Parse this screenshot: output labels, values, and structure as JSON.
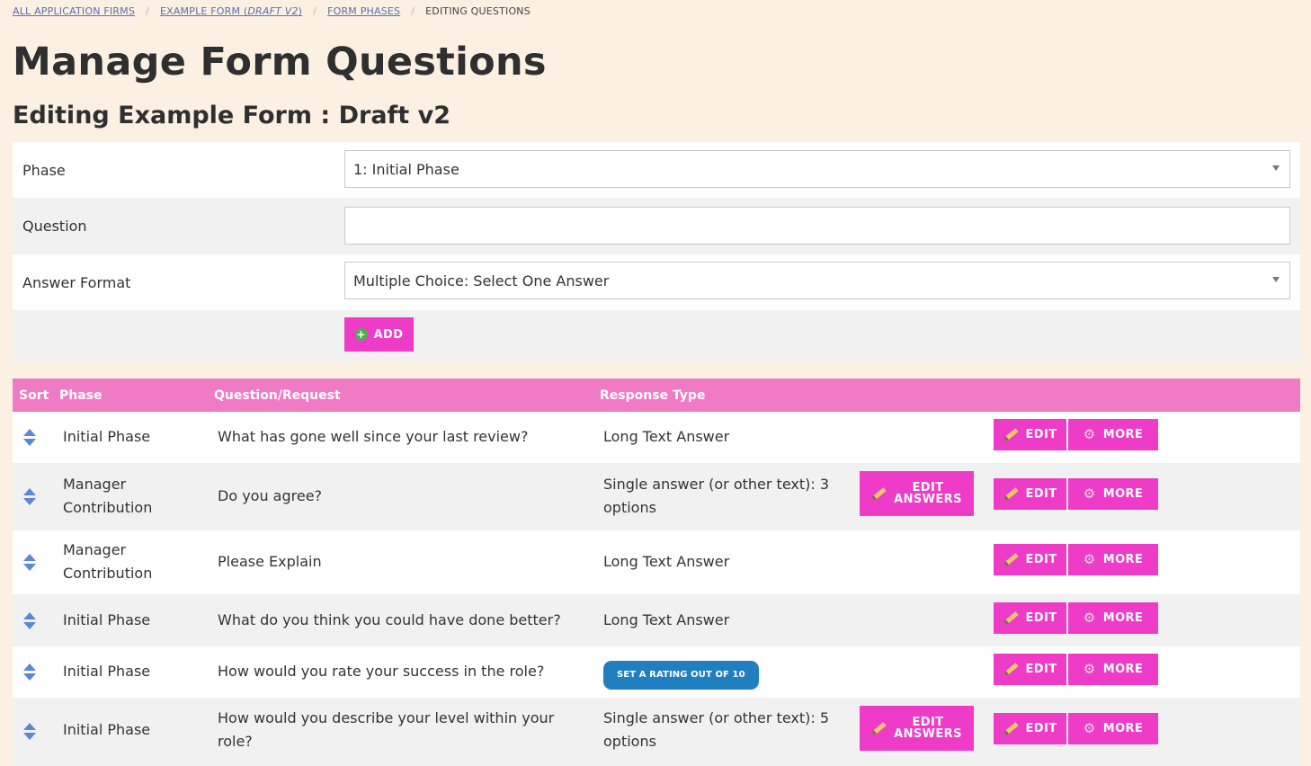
{
  "breadcrumb": {
    "items": [
      "ALL APPLICATION FIRMS",
      "EXAMPLE FORM (",
      "DRAFT V2",
      ")",
      "FORM PHASES"
    ],
    "current": "EDITING QUESTIONS",
    "separator": "/"
  },
  "page": {
    "title": "Manage Form Questions",
    "subtitle": "Editing Example Form : Draft v2"
  },
  "form": {
    "phase_label": "Phase",
    "phase_value": "1: Initial Phase",
    "question_label": "Question",
    "question_value": "",
    "answer_format_label": "Answer Format",
    "answer_format_value": "Multiple Choice: Select One Answer",
    "add_label": "ADD"
  },
  "table": {
    "headers": {
      "sort": "Sort",
      "phase": "Phase",
      "question": "Question/Request",
      "response": "Response Type"
    },
    "edit_label": "EDIT",
    "more_label": "MORE",
    "edit_answers_line1": "EDIT",
    "edit_answers_line2": "ANSWERS",
    "rows": [
      {
        "phase": "Initial Phase",
        "question": "What has gone well since your last review?",
        "response": "Long Text Answer"
      },
      {
        "phase": "Manager Contribution",
        "question": "Do you agree?",
        "response": "Single answer (or other text): 3 options"
      },
      {
        "phase": "Manager Contribution",
        "question": "Please Explain",
        "response": "Long Text Answer"
      },
      {
        "phase": "Initial Phase",
        "question": "What do you think you could have done better?",
        "response": "Long Text Answer"
      },
      {
        "phase": "Initial Phase",
        "question": "How would you rate your success in the role?",
        "response": "SET A RATING OUT OF 10"
      },
      {
        "phase": "Initial Phase",
        "question": "How would you describe your level within your role?",
        "response": "Single answer (or other text): 5 options"
      }
    ]
  },
  "colors": {
    "background": "#fbf0e2",
    "accent": "#ee3bc8",
    "table_header": "#f07bc4",
    "badge": "#1f7fbf",
    "sort_icon": "#5b87d6"
  }
}
